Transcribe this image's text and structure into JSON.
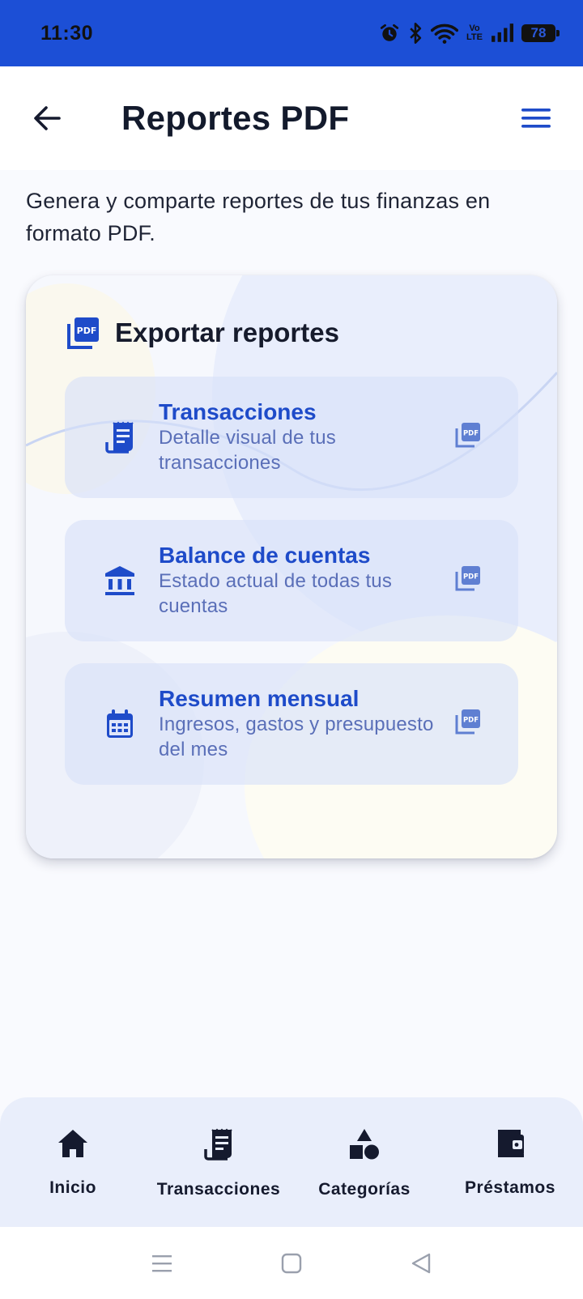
{
  "status_bar": {
    "time": "11:30",
    "volte_label_top": "Vo",
    "volte_label_bottom": "LTE",
    "battery": "78",
    "icons": [
      "alarm-icon",
      "bluetooth-icon",
      "wifi-icon",
      "volte-icon",
      "signal-icon",
      "battery-icon"
    ]
  },
  "header": {
    "title": "Reportes PDF",
    "back_icon": "arrow-left-icon",
    "menu_icon": "hamburger-menu-icon"
  },
  "intro_text": "Genera y comparte reportes de tus finanzas en formato PDF.",
  "export_card": {
    "title": "Exportar reportes",
    "icon": "pdf-stack-icon",
    "pdf_badge": "PDF",
    "items": [
      {
        "title": "Transacciones",
        "description": "Detalle visual de tus transacciones",
        "icon": "receipt-icon"
      },
      {
        "title": "Balance de cuentas",
        "description": "Estado actual de todas tus cuentas",
        "icon": "bank-icon"
      },
      {
        "title": "Resumen mensual",
        "description": "Ingresos, gastos y presupuesto del mes",
        "icon": "calendar-icon"
      }
    ]
  },
  "bottom_nav": {
    "items": [
      {
        "label": "Inicio",
        "icon": "home-icon"
      },
      {
        "label": "Transacciones",
        "icon": "receipt-icon"
      },
      {
        "label": "Categorías",
        "icon": "shapes-icon"
      },
      {
        "label": "Préstamos",
        "icon": "wallet-icon"
      }
    ]
  },
  "system_nav": {
    "icons": [
      "recents-icon",
      "home-square-icon",
      "back-triangle-icon"
    ]
  },
  "colors": {
    "status_bar": "#1c4fd6",
    "accent": "#1e4bc9",
    "description": "#5a6fb8",
    "bottom_nav_bg": "#e9eefb"
  }
}
